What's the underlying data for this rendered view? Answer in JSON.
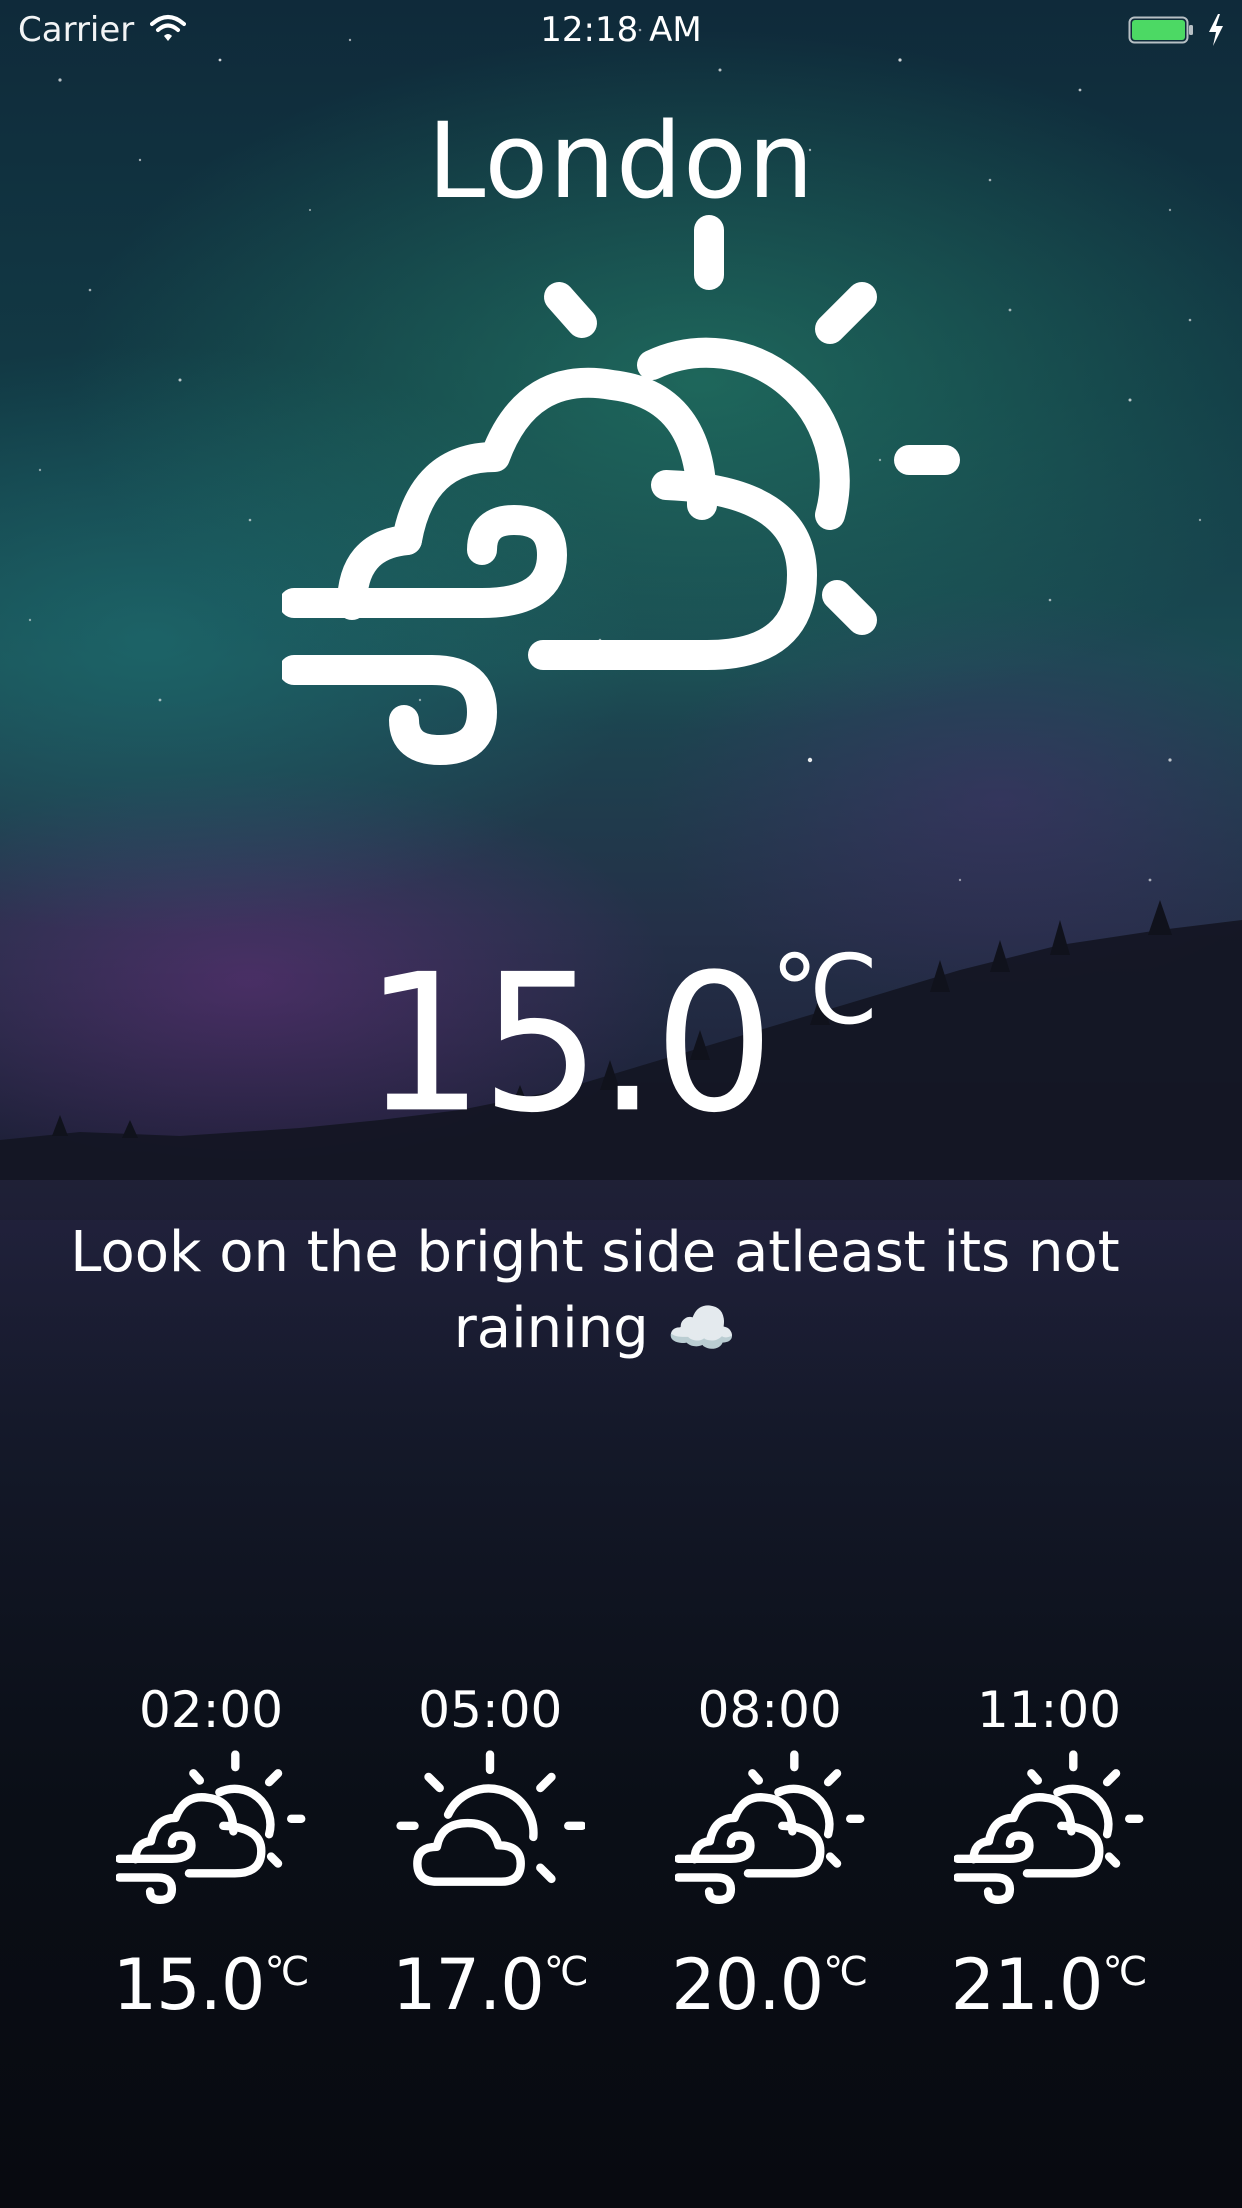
{
  "status_bar": {
    "carrier": "Carrier",
    "time": "12:18 AM",
    "wifi_icon": "wifi-icon",
    "battery_icon": "battery-icon",
    "charging_icon": "charging-bolt-icon",
    "battery_color": "#4cd964"
  },
  "weather": {
    "city": "London",
    "icon": "wind-cloud-sun-icon",
    "temperature": "15.0",
    "unit": "℃",
    "message": "Look on the bright side atleast its not raining ☁️"
  },
  "forecast": [
    {
      "time": "02:00",
      "icon": "wind-cloud-sun-icon",
      "temperature": "15.0",
      "unit": "℃"
    },
    {
      "time": "05:00",
      "icon": "cloud-sun-icon",
      "temperature": "17.0",
      "unit": "℃"
    },
    {
      "time": "08:00",
      "icon": "wind-cloud-sun-icon",
      "temperature": "20.0",
      "unit": "℃"
    },
    {
      "time": "11:00",
      "icon": "wind-cloud-sun-icon",
      "temperature": "21.0",
      "unit": "℃"
    }
  ]
}
